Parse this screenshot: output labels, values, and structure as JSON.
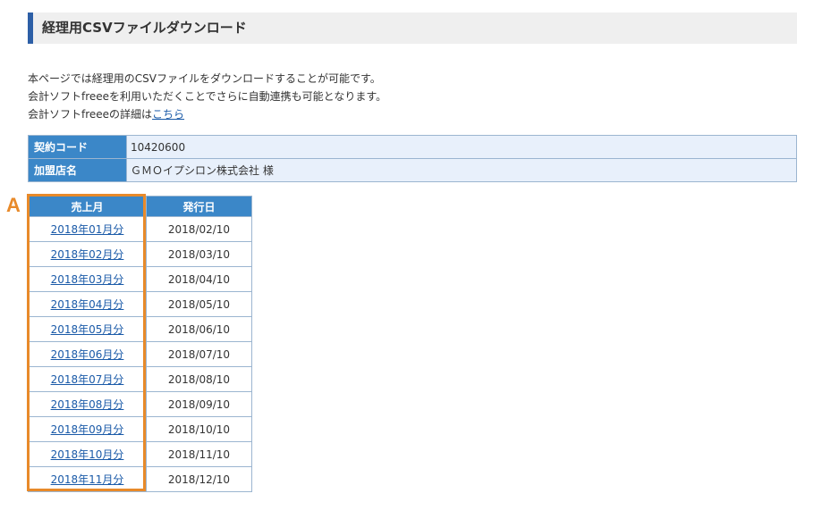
{
  "header": {
    "title": "経理用CSVファイルダウンロード"
  },
  "intro": {
    "line1": "本ページでは経理用のCSVファイルをダウンロードすることが可能です。",
    "line2": "会計ソフトfreeeを利用いただくことでさらに自動連携も可能となります。",
    "line3_prefix": "会計ソフトfreeeの詳細は",
    "line3_link": "こちら"
  },
  "info": {
    "contract_label": "契約コード",
    "contract_value": "10420600",
    "store_label": "加盟店名",
    "store_value": "ＧＭＯイプシロン株式会社 様"
  },
  "csv_table": {
    "headers": [
      "売上月",
      "発行日"
    ],
    "rows": [
      {
        "month": "2018年01月分",
        "date": "2018/02/10"
      },
      {
        "month": "2018年02月分",
        "date": "2018/03/10"
      },
      {
        "month": "2018年03月分",
        "date": "2018/04/10"
      },
      {
        "month": "2018年04月分",
        "date": "2018/05/10"
      },
      {
        "month": "2018年05月分",
        "date": "2018/06/10"
      },
      {
        "month": "2018年06月分",
        "date": "2018/07/10"
      },
      {
        "month": "2018年07月分",
        "date": "2018/08/10"
      },
      {
        "month": "2018年08月分",
        "date": "2018/09/10"
      },
      {
        "month": "2018年09月分",
        "date": "2018/10/10"
      },
      {
        "month": "2018年10月分",
        "date": "2018/11/10"
      },
      {
        "month": "2018年11月分",
        "date": "2018/12/10"
      }
    ]
  },
  "annotation": {
    "marker": "A",
    "color": "#e88a2a"
  },
  "colors": {
    "accent": "#2d5fa6",
    "table_header": "#3b87c8",
    "link": "#1a5aa8"
  }
}
